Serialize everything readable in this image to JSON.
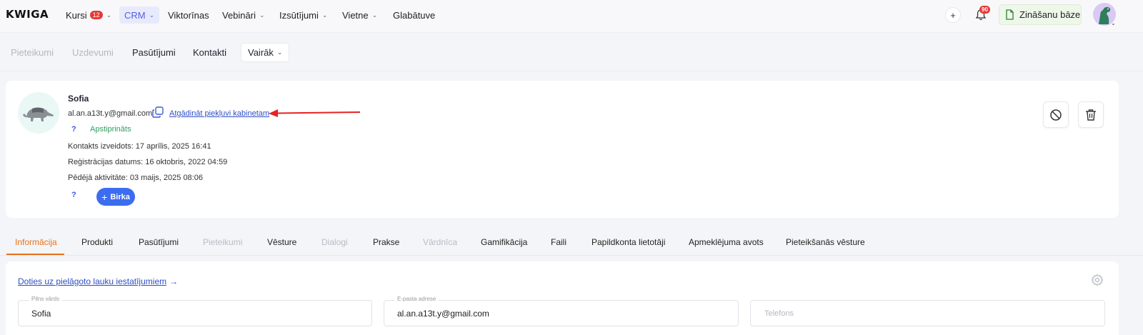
{
  "header": {
    "logo": "KWIGA",
    "nav": [
      {
        "label": "Kursi",
        "badge": "12"
      },
      {
        "label": "CRM"
      },
      {
        "label": "Viktorīnas"
      },
      {
        "label": "Vebināri"
      },
      {
        "label": "Izsūtījumi"
      },
      {
        "label": "Vietne"
      },
      {
        "label": "Glabātuve"
      }
    ],
    "add_icon": "plus-icon",
    "notifications_count": "90",
    "knowledge_base_label": "Zināšanu bāze",
    "accent": "#4f5fe0"
  },
  "subnav": {
    "items": [
      "Pieteikumi",
      "Uzdevumi",
      "Pasūtījumi",
      "Kontakti"
    ],
    "more_label": "Vairāk"
  },
  "profile": {
    "name": "Sofia",
    "email": "al.an.a13t.y@gmail.com",
    "remind_link": "Atgādināt piekļuvi kabinetam",
    "status_help": "?",
    "status": "Apstiprināts",
    "created_label": "Kontakts izveidots:",
    "created_value": "17 aprīlis, 2025 16:41",
    "registered_label": "Reģistrācijas datums:",
    "registered_value": "16 oktobris, 2022 04:59",
    "last_activity_label": "Pēdējā aktivitāte:",
    "last_activity_value": "03 maijs, 2025 08:06",
    "tag_help": "?",
    "tag_button": "Birka"
  },
  "tabs": [
    {
      "label": "Informācija",
      "state": "active"
    },
    {
      "label": "Produkti",
      "state": "normal"
    },
    {
      "label": "Pasūtījumi",
      "state": "normal"
    },
    {
      "label": "Pieteikumi",
      "state": "disabled"
    },
    {
      "label": "Vēsture",
      "state": "normal"
    },
    {
      "label": "Dialogi",
      "state": "disabled"
    },
    {
      "label": "Prakse",
      "state": "normal"
    },
    {
      "label": "Vārdnīca",
      "state": "disabled"
    },
    {
      "label": "Gamifikācija",
      "state": "normal"
    },
    {
      "label": "Faili",
      "state": "normal"
    },
    {
      "label": "Papildkonta lietotāji",
      "state": "normal"
    },
    {
      "label": "Apmeklējuma avots",
      "state": "normal"
    },
    {
      "label": "Pieteikšanās vēsture",
      "state": "normal"
    }
  ],
  "form": {
    "custom_fields_link": "Doties uz pielāgoto lauku iestatījumiem",
    "custom_fields_arrow": "→",
    "full_name_label": "Pilns vārds",
    "full_name_value": "Sofia",
    "email_label": "E-pasta adrese",
    "email_value": "al.an.a13t.y@gmail.com",
    "phone_placeholder": "Telefons"
  },
  "colors": {
    "active_tab": "#e8711a",
    "link": "#2f4fc4",
    "primary_button": "#3c6cf0",
    "status_ok": "#2f9e5e",
    "annotation_arrow": "#e52222"
  }
}
